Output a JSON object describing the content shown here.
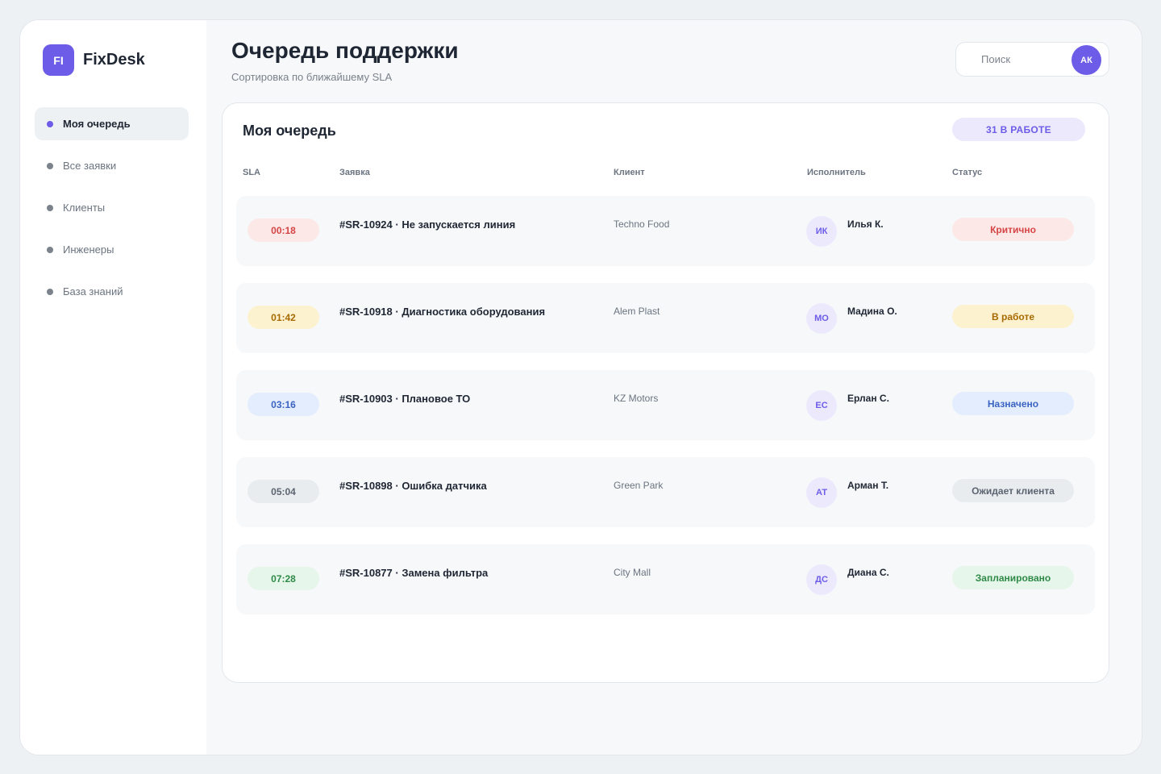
{
  "brand": {
    "logo": "FI",
    "name": "FixDesk"
  },
  "nav": [
    {
      "label": "Моя очередь",
      "active": true
    },
    {
      "label": "Все заявки",
      "active": false
    },
    {
      "label": "Клиенты",
      "active": false
    },
    {
      "label": "Инженеры",
      "active": false
    },
    {
      "label": "База знаний",
      "active": false
    }
  ],
  "header": {
    "title": "Очередь поддержки",
    "subtitle": "Сортировка по ближайшему SLA",
    "search_placeholder": "Поиск",
    "user_initials": "АК"
  },
  "queue": {
    "title": "Моя очередь",
    "badge": "31 В РАБОТЕ",
    "columns": {
      "sla": "SLA",
      "ticket": "Заявка",
      "client": "Клиент",
      "executor": "Исполнитель",
      "status": "Статус"
    },
    "rows": [
      {
        "sla": "00:18",
        "ticket": "#SR-10924 · Не запускается линия",
        "client": "Techno Food",
        "initials": "ИК",
        "executor": "Илья К.",
        "status": "Критично",
        "tone": "red"
      },
      {
        "sla": "01:42",
        "ticket": "#SR-10918 · Диагностика оборудования",
        "client": "Alem Plast",
        "initials": "МО",
        "executor": "Мадина О.",
        "status": "В работе",
        "tone": "yellow"
      },
      {
        "sla": "03:16",
        "ticket": "#SR-10903 · Плановое ТО",
        "client": "KZ Motors",
        "initials": "ЕС",
        "executor": "Ерлан С.",
        "status": "Назначено",
        "tone": "blue"
      },
      {
        "sla": "05:04",
        "ticket": "#SR-10898 · Ошибка датчика",
        "client": "Green Park",
        "initials": "АТ",
        "executor": "Арман Т.",
        "status": "Ожидает клиента",
        "tone": "gray"
      },
      {
        "sla": "07:28",
        "ticket": "#SR-10877 · Замена фильтра",
        "client": "City Mall",
        "initials": "ДС",
        "executor": "Диана С.",
        "status": "Запланировано",
        "tone": "green"
      }
    ]
  },
  "colors": {
    "accent": "#6c5ce7",
    "background": "#eef1f4"
  }
}
